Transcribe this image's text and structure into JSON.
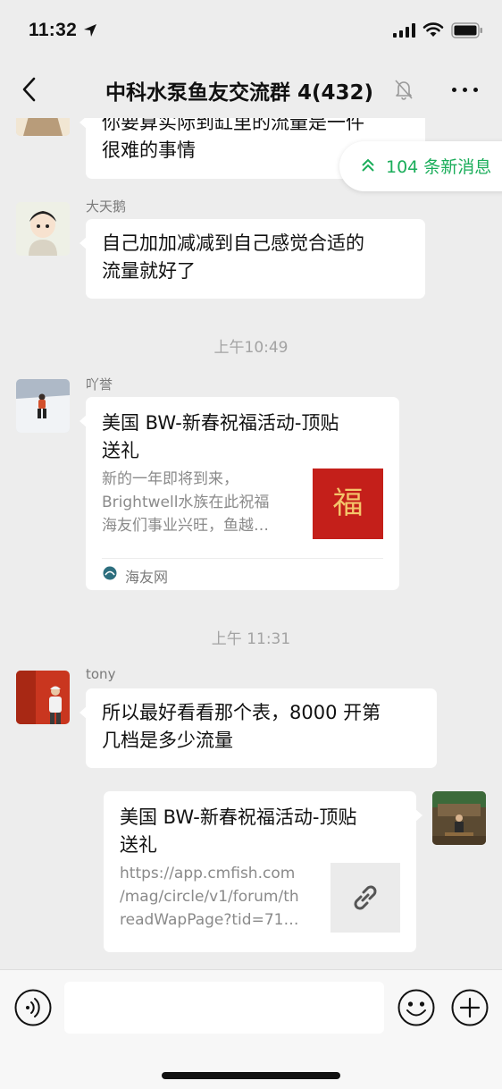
{
  "status": {
    "time": "11:32"
  },
  "nav": {
    "title": "中科水泵鱼友交流群 4(432)"
  },
  "new_messages": {
    "label": "104 条新消息"
  },
  "messages": [
    {
      "type": "text",
      "side": "left",
      "sender": "",
      "lines": [
        "你要算实际到缸里的流量是一件",
        "很难的事情"
      ]
    },
    {
      "type": "text",
      "side": "left",
      "sender": "大天鹅",
      "lines": [
        "自己加加减减到自己感觉合适的",
        "流量就好了"
      ]
    },
    {
      "type": "time",
      "text": "上午10:49"
    },
    {
      "type": "card",
      "side": "left",
      "sender": "吖誉",
      "title_lines": [
        "美国 BW-新春祝福活动-顶贴",
        "送礼"
      ],
      "desc_lines": [
        "新的一年即将到来，",
        "Brightwell水族在此祝福",
        "海友们事业兴旺，鱼越…"
      ],
      "thumb_text": "福",
      "source": "海友网"
    },
    {
      "type": "time",
      "text": "上午 11:31"
    },
    {
      "type": "text",
      "side": "left",
      "sender": "tony",
      "lines": [
        "所以最好看看那个表，8000 开第",
        "几档是多少流量"
      ]
    },
    {
      "type": "link_card",
      "side": "right",
      "title_lines": [
        "美国 BW-新春祝福活动-顶贴",
        "送礼"
      ],
      "desc_lines": [
        "https://app.cmfish.com",
        "/mag/circle/v1/forum/th",
        "readWapPage?tid=71…"
      ]
    }
  ],
  "colors": {
    "accent_green": "#1aad5a",
    "background": "#ededed",
    "bubble": "#ffffff"
  },
  "icons": [
    "location-arrow-icon",
    "signal-icon",
    "wifi-icon",
    "battery-icon",
    "back-icon",
    "mute-bell-icon",
    "more-icon",
    "double-chevron-up-icon",
    "voice-icon",
    "emoji-icon",
    "plus-icon",
    "link-icon"
  ]
}
